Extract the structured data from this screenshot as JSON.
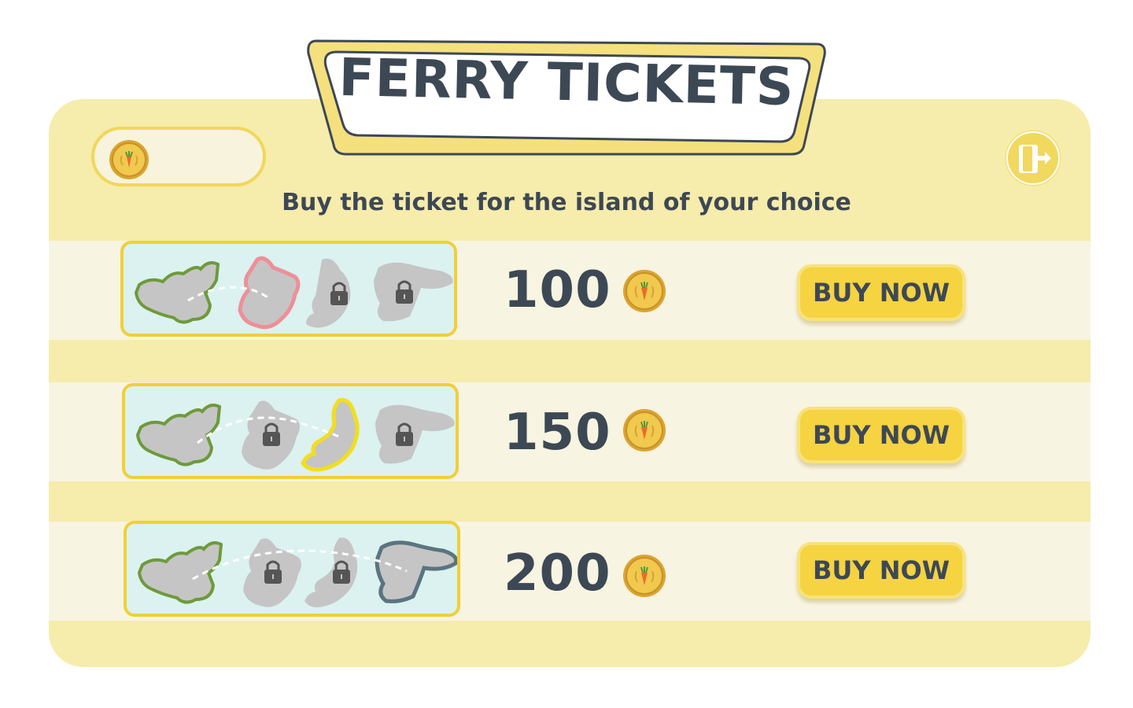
{
  "title": "FERRY TICKETS",
  "subtitle": "Buy the ticket for the island of your choice",
  "balance": {
    "value": ""
  },
  "colors": {
    "panel": "#f6ecab",
    "row_band": "#f8f4e2",
    "accent_yellow": "#f5d341",
    "text_dark": "#3d4855",
    "island_green": "#6e9a3a",
    "island_pink": "#ee8f98",
    "island_yellow": "#f3de1c",
    "island_slate": "#5a7480",
    "card_bg": "#dbf2f0"
  },
  "tickets": [
    {
      "price": "100",
      "buy_label": "BUY NOW",
      "destination": "island-2",
      "highlight_color": "#ee8f98"
    },
    {
      "price": "150",
      "buy_label": "BUY NOW",
      "destination": "island-3",
      "highlight_color": "#f3de1c"
    },
    {
      "price": "200",
      "buy_label": "BUY NOW",
      "destination": "island-4",
      "highlight_color": "#5a7480"
    }
  ],
  "icons": {
    "coin": "carrot-coin-icon",
    "exit": "exit-door-icon",
    "lock": "padlock-icon"
  }
}
